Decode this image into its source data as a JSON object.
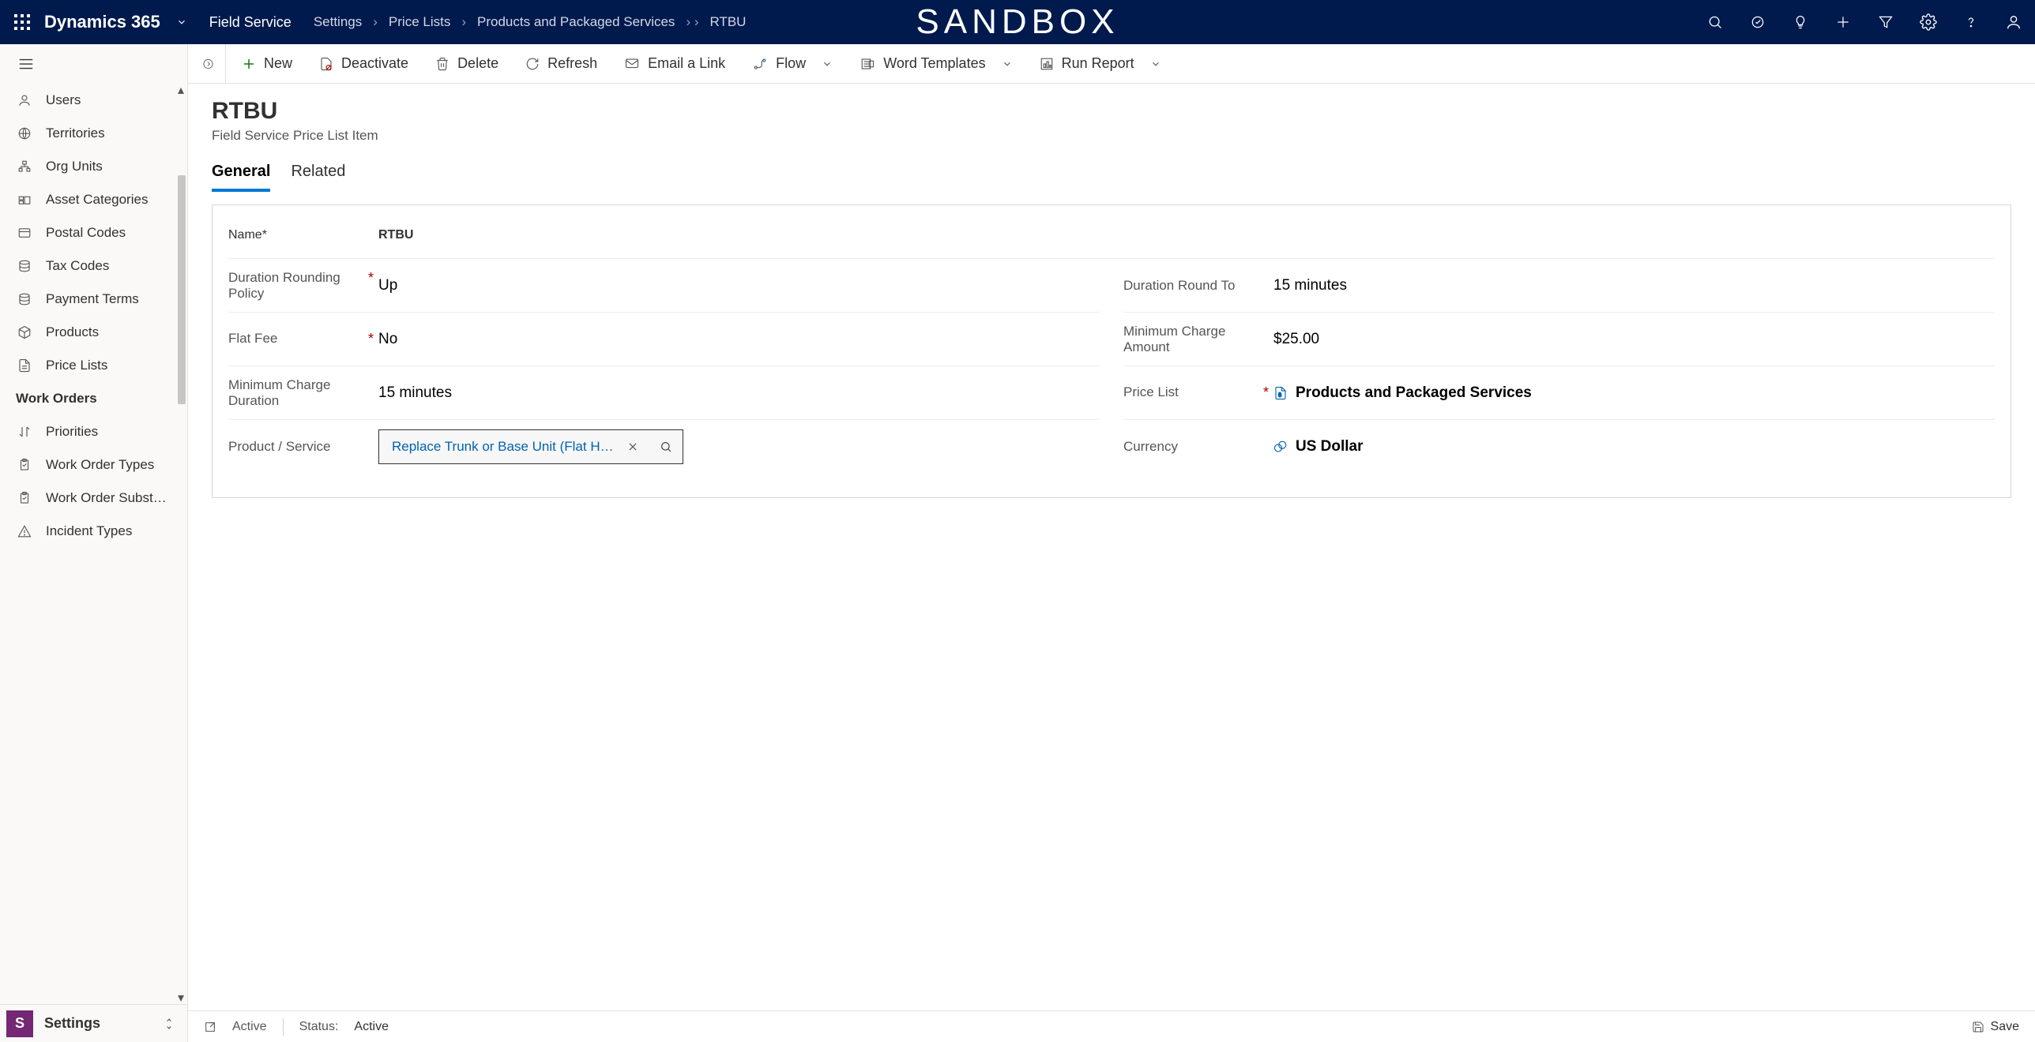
{
  "header": {
    "brand": "Dynamics 365",
    "area": "Field Service",
    "breadcrumb": [
      "Settings",
      "Price Lists",
      "Products and Packaged Services",
      "RTBU"
    ],
    "env_label": "SANDBOX"
  },
  "sidebar": {
    "items": [
      {
        "label": "Users",
        "icon": "person"
      },
      {
        "label": "Territories",
        "icon": "globe"
      },
      {
        "label": "Org Units",
        "icon": "org"
      },
      {
        "label": "Asset Categories",
        "icon": "assets"
      },
      {
        "label": "Postal Codes",
        "icon": "card"
      },
      {
        "label": "Tax Codes",
        "icon": "stack"
      },
      {
        "label": "Payment Terms",
        "icon": "stack"
      },
      {
        "label": "Products",
        "icon": "box"
      },
      {
        "label": "Price Lists",
        "icon": "doc"
      }
    ],
    "section_label": "Work Orders",
    "items2": [
      {
        "label": "Priorities",
        "icon": "sort"
      },
      {
        "label": "Work Order Types",
        "icon": "clip"
      },
      {
        "label": "Work Order Subst…",
        "icon": "clip"
      },
      {
        "label": "Incident Types",
        "icon": "warn"
      }
    ],
    "area_badge": "S",
    "area_name": "Settings"
  },
  "commands": {
    "new": "New",
    "deactivate": "Deactivate",
    "delete": "Delete",
    "refresh": "Refresh",
    "email": "Email a Link",
    "flow": "Flow",
    "word": "Word Templates",
    "report": "Run Report"
  },
  "page": {
    "title": "RTBU",
    "subtitle": "Field Service Price List Item",
    "tabs": {
      "general": "General",
      "related": "Related"
    },
    "fields": {
      "name_label": "Name",
      "name_value": "RTBU",
      "drp_label": "Duration Rounding Policy",
      "drp_value": "Up",
      "drt_label": "Duration Round To",
      "drt_value": "15 minutes",
      "flat_label": "Flat Fee",
      "flat_value": "No",
      "mca_label": "Minimum Charge Amount",
      "mca_value": "$25.00",
      "mcd_label": "Minimum Charge Duration",
      "mcd_value": "15 minutes",
      "pl_label": "Price List",
      "pl_value": "Products and Packaged Services",
      "ps_label": "Product / Service",
      "ps_value": "Replace Trunk or Base Unit (Flat H…",
      "currency_label": "Currency",
      "currency_value": "US Dollar"
    }
  },
  "status": {
    "state": "Active",
    "status_label": "Status:",
    "status_value": "Active",
    "save": "Save"
  }
}
